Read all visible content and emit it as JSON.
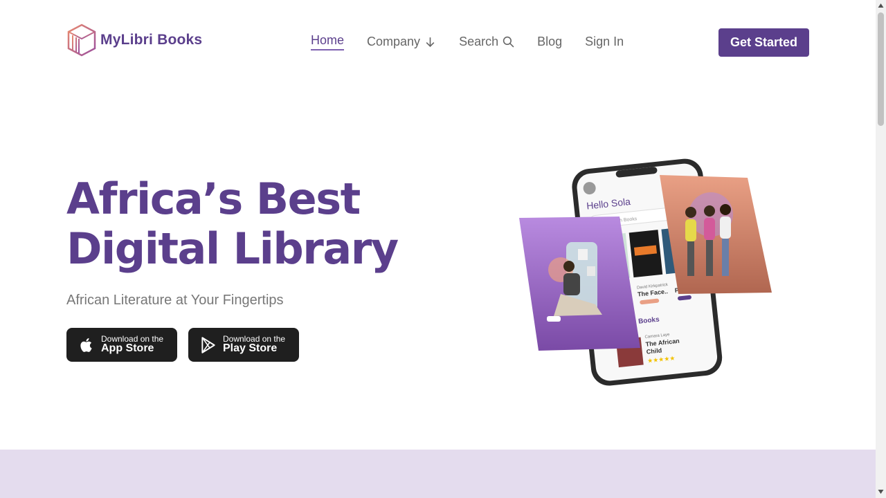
{
  "brand": {
    "name": "MyLibri Books",
    "logo_icon": "books-cube-logo-icon"
  },
  "nav": {
    "home": "Home",
    "company": "Company",
    "search": "Search",
    "blog": "Blog",
    "sign_in": "Sign In",
    "cta": "Get Started"
  },
  "hero": {
    "title_line1": "Africa’s Best",
    "title_line2": "Digital Library",
    "subtitle": "African Literature at Your Fingertips"
  },
  "stores": {
    "apple": {
      "small": "Download on the",
      "big": "App Store",
      "icon": "apple-icon"
    },
    "play": {
      "small": "Download on the",
      "big": "Play Store",
      "icon": "play-icon"
    }
  },
  "phone": {
    "greeting": "Hello Sola",
    "search_placeholder": "Search Books",
    "book1_author": "David Kirkpatrick",
    "book1_title": "The Face..",
    "book2_title": "Plea",
    "section_title": "ng Books",
    "book3_author": "Camara Laye",
    "book3_title_line1": "The African",
    "book3_title_line2": "Child",
    "rating": "★★★★★"
  },
  "colors": {
    "brand": "#5b3f8c",
    "band": "#e4dcee",
    "store_bg": "#1f1f1f"
  }
}
